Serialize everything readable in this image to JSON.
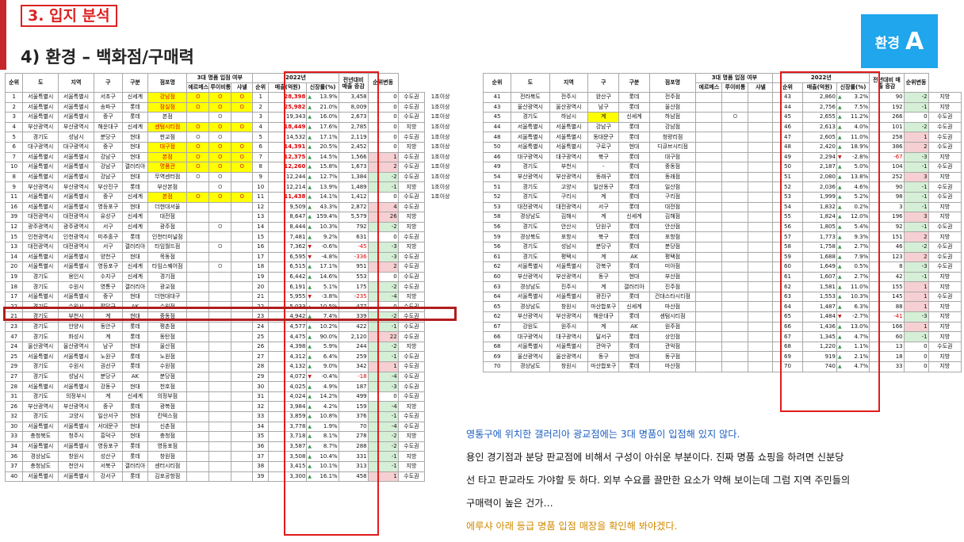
{
  "section": "3. 입지 분석",
  "subtitle": "4) 환경 – 백화점/구매력",
  "badge": {
    "label": "환경",
    "letter": "A"
  },
  "left": {
    "headers": {
      "h1": [
        "순위",
        "도",
        "지역",
        "구",
        "구분",
        "점포명",
        "3대 명품 입점 여부",
        "2022년",
        "전년대비 매출 증감",
        "순위변동"
      ],
      "h2": [
        "에르메스",
        "루이비통",
        "샤넬",
        "순위",
        "매출(억원)",
        "신장률(%)"
      ]
    },
    "rows": [
      [
        "1",
        "서울특별시",
        "서울특별시",
        "서초구",
        "신세계",
        "강남점",
        "O",
        "O",
        "O",
        "1",
        "28,398",
        "13.9%",
        "3,458",
        "0",
        "수도권",
        "1조이상",
        "red",
        "up"
      ],
      [
        "2",
        "서울특별시",
        "서울특별시",
        "송파구",
        "롯데",
        "잠실점",
        "O",
        "O",
        "O",
        "2",
        "25,982",
        "21.0%",
        "8,009",
        "0",
        "수도권",
        "1조이상",
        "red",
        "up"
      ],
      [
        "3",
        "서울특별시",
        "서울특별시",
        "중구",
        "롯데",
        "본점",
        "",
        "O",
        "",
        "3",
        "19,343",
        "16.0%",
        "2,673",
        "0",
        "수도권",
        "1조이상",
        "",
        "up"
      ],
      [
        "4",
        "부산광역시",
        "부산광역시",
        "해운대구",
        "신세계",
        "센텀시티점",
        "O",
        "O",
        "O",
        "4",
        "18,449",
        "17.6%",
        "2,785",
        "0",
        "지방",
        "1조이상",
        "red",
        "up"
      ],
      [
        "5",
        "경기도",
        "성남시",
        "분당구",
        "현대",
        "판교점",
        "O",
        "O",
        "",
        "5",
        "14,532",
        "17.1%",
        "2,119",
        "0",
        "수도권",
        "1조이상",
        "",
        "up"
      ],
      [
        "6",
        "대구광역시",
        "대구광역시",
        "중구",
        "현대",
        "대구점",
        "O",
        "O",
        "O",
        "6",
        "14,391",
        "20.5%",
        "2,452",
        "0",
        "지방",
        "1조이상",
        "red",
        "up"
      ],
      [
        "7",
        "서울특별시",
        "서울특별시",
        "강남구",
        "현대",
        "본점",
        "O",
        "O",
        "O",
        "7",
        "12,375",
        "14.5%",
        "1,566",
        "1",
        "수도권",
        "1조이상",
        "red",
        "up"
      ],
      [
        "10",
        "서울특별시",
        "서울특별시",
        "강남구",
        "갤러리아",
        "명품관",
        "O",
        "O",
        "O",
        "8",
        "12,260",
        "15.8%",
        "1,673",
        "2",
        "수도권",
        "1조이상",
        "red",
        "up"
      ],
      [
        "8",
        "서울특별시",
        "서울특별시",
        "강남구",
        "현대",
        "무역센터점",
        "O",
        "O",
        "",
        "9",
        "12,244",
        "12.7%",
        "1,384",
        "-2",
        "수도권",
        "1조이상",
        "",
        "up"
      ],
      [
        "9",
        "부산광역시",
        "부산광역시",
        "부산진구",
        "롯데",
        "부산본점",
        "",
        "O",
        "",
        "10",
        "12,214",
        "13.9%",
        "1,489",
        "-1",
        "지방",
        "1조이상",
        "",
        "up"
      ],
      [
        "11",
        "서울특별시",
        "서울특별시",
        "중구",
        "신세계",
        "본점",
        "O",
        "O",
        "O",
        "11",
        "11,438",
        "14.1%",
        "1,412",
        "0",
        "수도권",
        "1조이상",
        "red",
        "up"
      ],
      [
        "16",
        "서울특별시",
        "서울특별시",
        "영등포구",
        "현대",
        "더현대서울",
        "",
        "",
        "",
        "12",
        "9,509",
        "43.3%",
        "2,872",
        "4",
        "수도권",
        "",
        "",
        "up"
      ],
      [
        "39",
        "대전광역시",
        "대전광역시",
        "유성구",
        "신세계",
        "대전점",
        "",
        "",
        "",
        "13",
        "8,647",
        "159.4%",
        "5,579",
        "26",
        "지방",
        "",
        "",
        "up"
      ],
      [
        "12",
        "광주광역시",
        "광주광역시",
        "서구",
        "신세계",
        "광주점",
        "",
        "O",
        "",
        "14",
        "8,444",
        "10.3%",
        "792",
        "-2",
        "지방",
        "",
        "",
        "up"
      ],
      [
        "15",
        "인천광역시",
        "인천광역시",
        "미추홀구",
        "롯데",
        "인천터미널점",
        "",
        "",
        "",
        "15",
        "7,481",
        "9.2%",
        "631",
        "0",
        "수도권",
        "",
        "",
        "up"
      ],
      [
        "13",
        "대전광역시",
        "대전광역시",
        "서구",
        "갤러리아",
        "타임월드점",
        "",
        "O",
        "",
        "16",
        "7,362",
        "-0.6%",
        "-45",
        "-3",
        "지방",
        "",
        "",
        "dn"
      ],
      [
        "14",
        "서울특별시",
        "서울특별시",
        "양천구",
        "현대",
        "목동점",
        "",
        "",
        "",
        "17",
        "6,595",
        "-4.8%",
        "-336",
        "-3",
        "수도권",
        "",
        "",
        "dn"
      ],
      [
        "20",
        "서울특별시",
        "서울특별시",
        "영등포구",
        "신세계",
        "타임스퀘어점",
        "",
        "O",
        "",
        "18",
        "6,515",
        "17.1%",
        "951",
        "2",
        "수도권",
        "",
        "",
        "up"
      ],
      [
        "19",
        "경기도",
        "용인시",
        "수지구",
        "신세계",
        "경기점",
        "",
        "",
        "",
        "19",
        "6,442",
        "14.6%",
        "553",
        "0",
        "수도권",
        "",
        "",
        "up"
      ],
      [
        "18",
        "경기도",
        "수원시",
        "영통구",
        "갤러리아",
        "광교점",
        "",
        "",
        "",
        "20",
        "6,191",
        "5.1%",
        "175",
        "-2",
        "수도권",
        "",
        "",
        "up"
      ],
      [
        "17",
        "서울특별시",
        "서울특별시",
        "중구",
        "현대",
        "더현대대구",
        "",
        "",
        "",
        "21",
        "5,955",
        "-3.8%",
        "-235",
        "-4",
        "지방",
        "",
        "",
        "dn"
      ],
      [
        "22",
        "경기도",
        "수원시",
        "팔달구",
        "AK",
        "수원점",
        "",
        "",
        "",
        "22",
        "5,033",
        "10.5%",
        "477",
        "0",
        "수도권",
        "",
        "",
        "up"
      ],
      [
        "21",
        "경기도",
        "부천시",
        "계",
        "현대",
        "중동점",
        "",
        "",
        "",
        "23",
        "4,942",
        "7.4%",
        "339",
        "-2",
        "수도권",
        "",
        "",
        "up"
      ],
      [
        "23",
        "경기도",
        "안양시",
        "동안구",
        "롯데",
        "평촌점",
        "",
        "",
        "",
        "24",
        "4,577",
        "10.2%",
        "422",
        "-1",
        "수도권",
        "",
        "",
        "up"
      ],
      [
        "47",
        "경기도",
        "화성시",
        "계",
        "롯데",
        "동탄점",
        "",
        "",
        "",
        "25",
        "4,475",
        "90.0%",
        "2,120",
        "22",
        "수도권",
        "",
        "",
        "up"
      ],
      [
        "24",
        "울산광역시",
        "울산광역시",
        "남구",
        "현대",
        "울산점",
        "",
        "",
        "",
        "26",
        "4,398",
        "5.9%",
        "244",
        "-2",
        "지방",
        "",
        "",
        "up"
      ],
      [
        "25",
        "서울특별시",
        "서울특별시",
        "노원구",
        "롯데",
        "노원점",
        "",
        "",
        "",
        "27",
        "4,312",
        "6.4%",
        "259",
        "-1",
        "수도권",
        "",
        "",
        "up"
      ],
      [
        "29",
        "경기도",
        "수원시",
        "권선구",
        "롯데",
        "수원점",
        "",
        "",
        "",
        "28",
        "4,132",
        "9.0%",
        "342",
        "1",
        "수도권",
        "",
        "",
        "up"
      ],
      [
        "27",
        "경기도",
        "성남시",
        "분당구",
        "AK",
        "분당점",
        "",
        "",
        "",
        "29",
        "4,072",
        "-0.4%",
        "-18",
        "-4",
        "수도권",
        "",
        "",
        "dn"
      ],
      [
        "28",
        "서울특별시",
        "서울특별시",
        "강동구",
        "현대",
        "천호점",
        "",
        "",
        "",
        "30",
        "4,025",
        "4.9%",
        "187",
        "-3",
        "수도권",
        "",
        "",
        "up"
      ],
      [
        "31",
        "경기도",
        "의정부시",
        "계",
        "신세계",
        "의정부점",
        "",
        "",
        "",
        "31",
        "4,024",
        "14.2%",
        "499",
        "0",
        "수도권",
        "",
        "",
        "up"
      ],
      [
        "26",
        "부산광역시",
        "부산광역시",
        "중구",
        "롯데",
        "광복점",
        "",
        "",
        "",
        "32",
        "3,984",
        "4.2%",
        "159",
        "-4",
        "지방",
        "",
        "",
        "up"
      ],
      [
        "32",
        "경기도",
        "고양시",
        "일산서구",
        "현대",
        "킨텍스점",
        "",
        "",
        "",
        "33",
        "3,859",
        "10.8%",
        "376",
        "-1",
        "수도권",
        "",
        "",
        "up"
      ],
      [
        "30",
        "서울특별시",
        "서울특별시",
        "서대문구",
        "현대",
        "신촌점",
        "",
        "",
        "",
        "34",
        "3,778",
        "1.9%",
        "70",
        "-4",
        "수도권",
        "",
        "",
        "up"
      ],
      [
        "33",
        "충청북도",
        "청주시",
        "흥덕구",
        "현대",
        "충청점",
        "",
        "",
        "",
        "35",
        "3,718",
        "8.1%",
        "278",
        "-2",
        "지방",
        "",
        "",
        "up"
      ],
      [
        "34",
        "서울특별시",
        "서울특별시",
        "영등포구",
        "롯데",
        "영등포점",
        "",
        "",
        "",
        "36",
        "3,587",
        "8.7%",
        "288",
        "-2",
        "수도권",
        "",
        "",
        "up"
      ],
      [
        "36",
        "경상남도",
        "창원시",
        "성산구",
        "롯데",
        "창원점",
        "",
        "",
        "",
        "37",
        "3,508",
        "10.4%",
        "331",
        "-1",
        "지방",
        "",
        "",
        "up"
      ],
      [
        "37",
        "충청남도",
        "천안시",
        "서북구",
        "갤러리아",
        "센터시티점",
        "",
        "",
        "",
        "38",
        "3,415",
        "10.1%",
        "313",
        "-1",
        "지방",
        "",
        "",
        "up"
      ],
      [
        "40",
        "서울특별시",
        "서울특별시",
        "강서구",
        "롯데",
        "김포공항점",
        "",
        "",
        "",
        "39",
        "3,300",
        "16.1%",
        "458",
        "1",
        "수도권",
        "",
        "",
        "up"
      ]
    ]
  },
  "right": {
    "headers": {
      "h1": [
        "순위",
        "도",
        "지역",
        "구",
        "구분",
        "점포명",
        "3대 명품 입점 여부",
        "2022년",
        "전년대비 매출 증감",
        "순위변동"
      ],
      "h2": [
        "에르메스",
        "루이비통",
        "샤넬",
        "순위",
        "매출(억원)",
        "신장률(%)"
      ]
    },
    "rows": [
      [
        "41",
        "전라북도",
        "전주시",
        "완산구",
        "롯데",
        "전주점",
        "",
        "",
        "",
        "43",
        "2,860",
        "3.2%",
        "90",
        "-2",
        "지방",
        "",
        "",
        "up"
      ],
      [
        "43",
        "울산광역시",
        "울산광역시",
        "남구",
        "롯데",
        "울산점",
        "",
        "",
        "",
        "44",
        "2,756",
        "7.5%",
        "192",
        "-1",
        "지방",
        "",
        "",
        "up"
      ],
      [
        "45",
        "경기도",
        "하남시",
        "계",
        "신세계",
        "하남점",
        "",
        "O",
        "",
        "45",
        "2,655",
        "11.2%",
        "266",
        "0",
        "수도권",
        "",
        "",
        "up"
      ],
      [
        "44",
        "서울특별시",
        "서울특별시",
        "강남구",
        "롯데",
        "강남점",
        "",
        "",
        "",
        "46",
        "2,613",
        "4.0%",
        "101",
        "-2",
        "수도권",
        "",
        "",
        "up"
      ],
      [
        "48",
        "서울특별시",
        "서울특별시",
        "동대문구",
        "롯데",
        "청량리점",
        "",
        "",
        "",
        "47",
        "2,605",
        "11.0%",
        "258",
        "1",
        "수도권",
        "",
        "",
        "up"
      ],
      [
        "50",
        "서울특별시",
        "서울특별시",
        "구로구",
        "현대",
        "디큐브시티점",
        "",
        "",
        "",
        "48",
        "2,420",
        "18.9%",
        "386",
        "2",
        "수도권",
        "",
        "",
        "up"
      ],
      [
        "46",
        "대구광역시",
        "대구광역시",
        "북구",
        "롯데",
        "대구점",
        "",
        "",
        "",
        "49",
        "2,294",
        "-2.8%",
        "-67",
        "-3",
        "지방",
        "",
        "",
        "dn"
      ],
      [
        "49",
        "경기도",
        "부천시",
        "-",
        "롯데",
        "중동점",
        "",
        "",
        "",
        "50",
        "2,187",
        "5.0%",
        "104",
        "-1",
        "수도권",
        "",
        "",
        "up"
      ],
      [
        "54",
        "부산광역시",
        "부산광역시",
        "동래구",
        "롯데",
        "동래점",
        "",
        "",
        "",
        "51",
        "2,080",
        "13.8%",
        "252",
        "3",
        "지방",
        "",
        "",
        "up"
      ],
      [
        "51",
        "경기도",
        "고양시",
        "일산동구",
        "롯데",
        "일산점",
        "",
        "",
        "",
        "52",
        "2,036",
        "4.6%",
        "90",
        "-1",
        "수도권",
        "",
        "",
        "up"
      ],
      [
        "52",
        "경기도",
        "구리시",
        "계",
        "롯데",
        "구리점",
        "",
        "",
        "",
        "53",
        "1,999",
        "5.2%",
        "98",
        "-1",
        "수도권",
        "",
        "",
        "up"
      ],
      [
        "53",
        "대전광역시",
        "대전광역시",
        "서구",
        "롯데",
        "대전점",
        "",
        "",
        "",
        "54",
        "1,832",
        "0.2%",
        "3",
        "-1",
        "지방",
        "",
        "",
        "up"
      ],
      [
        "58",
        "경상남도",
        "김해시",
        "계",
        "신세계",
        "김해점",
        "",
        "",
        "",
        "55",
        "1,824",
        "12.0%",
        "196",
        "3",
        "지방",
        "",
        "",
        "up"
      ],
      [
        "56",
        "경기도",
        "안산시",
        "단원구",
        "롯데",
        "안산점",
        "",
        "",
        "",
        "56",
        "1,805",
        "5.4%",
        "92",
        "-1",
        "수도권",
        "",
        "",
        "up"
      ],
      [
        "59",
        "경상북도",
        "포항시",
        "북구",
        "롯데",
        "포항점",
        "",
        "",
        "",
        "57",
        "1,773",
        "9.3%",
        "151",
        "2",
        "지방",
        "",
        "",
        "up"
      ],
      [
        "56",
        "경기도",
        "성남시",
        "분당구",
        "롯데",
        "분당점",
        "",
        "",
        "",
        "58",
        "1,758",
        "2.7%",
        "46",
        "-2",
        "수도권",
        "",
        "",
        "up"
      ],
      [
        "61",
        "경기도",
        "평택시",
        "계",
        "AK",
        "평택점",
        "",
        "",
        "",
        "59",
        "1,688",
        "7.9%",
        "123",
        "2",
        "수도권",
        "",
        "",
        "up"
      ],
      [
        "62",
        "서울특별시",
        "서울특별시",
        "강북구",
        "롯데",
        "미아점",
        "",
        "",
        "",
        "60",
        "1,649",
        "0.5%",
        "8",
        "-3",
        "수도권",
        "",
        "",
        "up"
      ],
      [
        "60",
        "부산광역시",
        "부산광역시",
        "동구",
        "현대",
        "부산점",
        "",
        "",
        "",
        "61",
        "1,607",
        "2.7%",
        "42",
        "-1",
        "지방",
        "",
        "",
        "up"
      ],
      [
        "63",
        "경상남도",
        "진주시",
        "계",
        "갤러리아",
        "진주점",
        "",
        "",
        "",
        "62",
        "1,581",
        "11.0%",
        "155",
        "1",
        "지방",
        "",
        "",
        "up"
      ],
      [
        "64",
        "서울특별시",
        "서울특별시",
        "광진구",
        "롯데",
        "건대스타시티점",
        "",
        "",
        "",
        "63",
        "1,553",
        "10.3%",
        "145",
        "1",
        "수도권",
        "",
        "",
        "up"
      ],
      [
        "65",
        "경상남도",
        "창원시",
        "마산합포구",
        "신세계",
        "마산점",
        "",
        "",
        "",
        "64",
        "1,487",
        "6.3%",
        "88",
        "1",
        "지방",
        "",
        "",
        "up"
      ],
      [
        "62",
        "부산광역시",
        "부산광역시",
        "해운대구",
        "롯데",
        "센텀시티점",
        "",
        "",
        "",
        "65",
        "1,484",
        "-2.7%",
        "-41",
        "-3",
        "지방",
        "",
        "",
        "dn"
      ],
      [
        "67",
        "강원도",
        "원주시",
        "계",
        "AK",
        "원주점",
        "",
        "",
        "",
        "66",
        "1,436",
        "13.0%",
        "166",
        "1",
        "지방",
        "",
        "",
        "up"
      ],
      [
        "66",
        "대구광역시",
        "대구광역시",
        "달서구",
        "롯데",
        "상인점",
        "",
        "",
        "",
        "67",
        "1,345",
        "4.7%",
        "60",
        "-1",
        "지방",
        "",
        "",
        "up"
      ],
      [
        "68",
        "서울특별시",
        "서울특별시",
        "관악구",
        "롯데",
        "관악점",
        "",
        "",
        "",
        "68",
        "1,220",
        "1.1%",
        "13",
        "0",
        "수도권",
        "",
        "",
        "up"
      ],
      [
        "69",
        "울산광역시",
        "울산광역시",
        "동구",
        "현대",
        "동구점",
        "",
        "",
        "",
        "69",
        "919",
        "2.1%",
        "18",
        "0",
        "지방",
        "",
        "",
        "up"
      ],
      [
        "70",
        "경상남도",
        "창원시",
        "마산합포구",
        "롯데",
        "마산점",
        "",
        "",
        "",
        "70",
        "740",
        "4.7%",
        "33",
        "0",
        "지방",
        "",
        "",
        "up"
      ]
    ]
  },
  "notes": [
    "영통구에 위치한 갤러리아 광교점에는 3대 명품이 입점해 있지 않다.",
    "용인 경기점과 분당 판교점에 비해서 구성이 아쉬운 부분이다. 진짜 명품 쇼핑을 하려면 신분당",
    "선 타고 판교라도 가야할 듯 하다. 외부 수요를 끌만한 요소가 약해 보이는데 그럼 지역 주민들의",
    "구매력이 높은 건가…",
    "에루샤 아래 등급 명품 입점 매장을 확인해 봐야겠다."
  ]
}
